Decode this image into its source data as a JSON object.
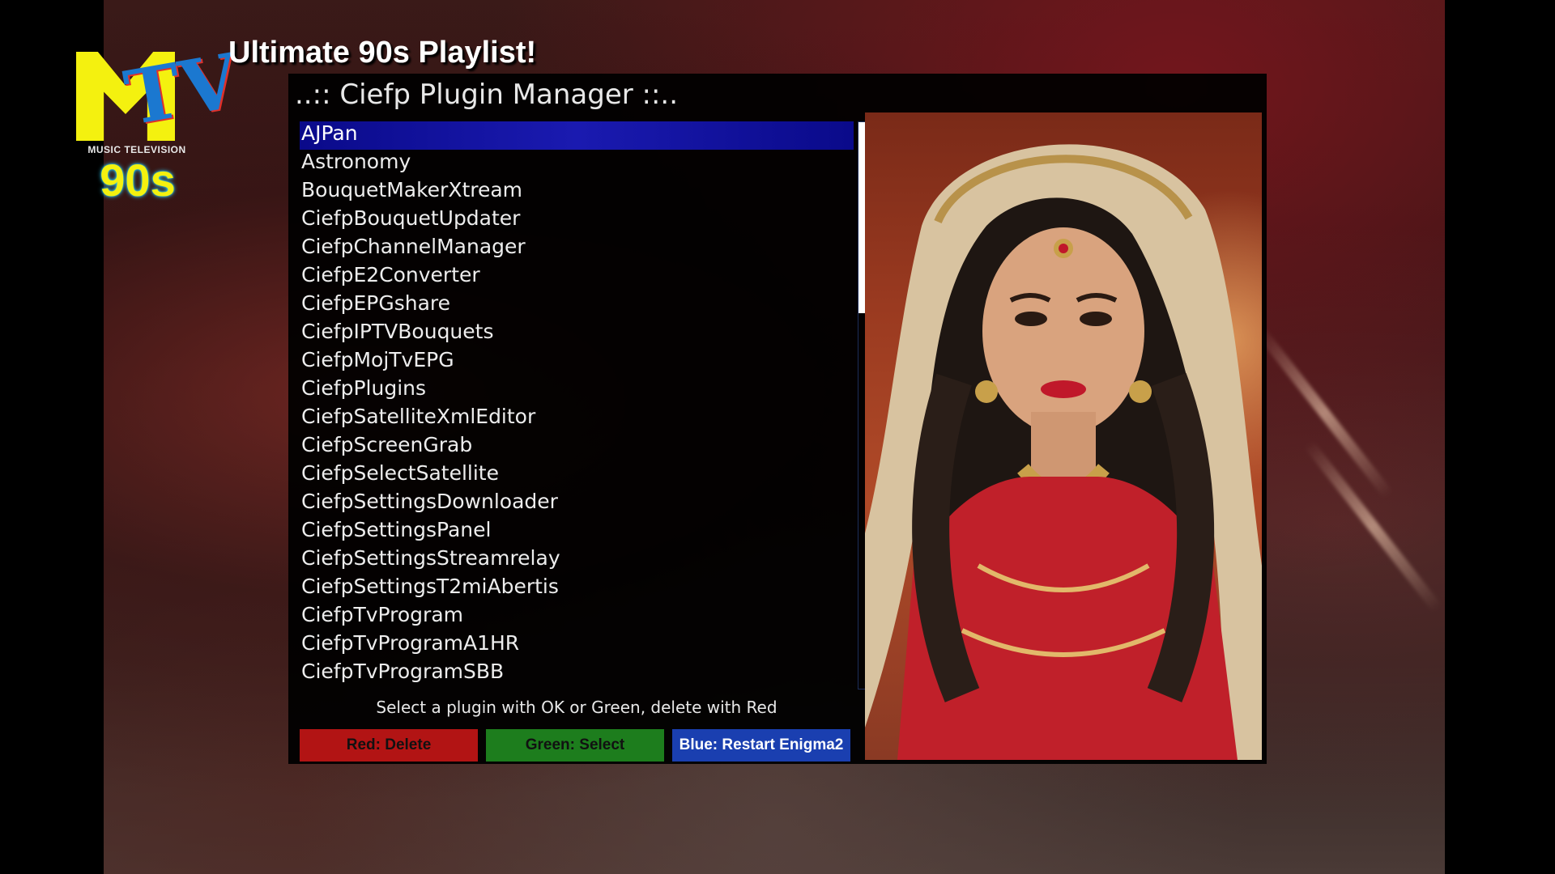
{
  "overlay": {
    "logo_tv_text": "TV",
    "logo_subtitle": "MUSIC TELEVISION",
    "logo_decade": "90s",
    "channel_title": "Ultimate 90s Playlist!"
  },
  "window": {
    "title": "..:: Ciefp Plugin Manager ::..",
    "plugins": [
      "AJPan",
      "Astronomy",
      "BouquetMakerXtream",
      "CiefpBouquetUpdater",
      "CiefpChannelManager",
      "CiefpE2Converter",
      "CiefpEPGshare",
      "CiefpIPTVBouquets",
      "CiefpMojTvEPG",
      "CiefpPlugins",
      "CiefpSatelliteXmlEditor",
      "CiefpScreenGrab",
      "CiefpSelectSatellite",
      "CiefpSettingsDownloader",
      "CiefpSettingsPanel",
      "CiefpSettingsStreamrelay",
      "CiefpSettingsT2miAbertis",
      "CiefpTvProgram",
      "CiefpTvProgramA1HR",
      "CiefpTvProgramSBB"
    ],
    "selected_index": 0,
    "hint": "Select a plugin with OK or Green, delete with Red",
    "buttons": {
      "red": "Red: Delete",
      "green": "Green: Select",
      "blue": "Blue: Restart Enigma2"
    }
  },
  "colors": {
    "selection": "#1a1ab0",
    "red_button": "#b21414",
    "green_button": "#1d7d1d",
    "blue_button": "#1a3fb0"
  },
  "icons": {
    "logo": "mtv-90s-logo"
  }
}
